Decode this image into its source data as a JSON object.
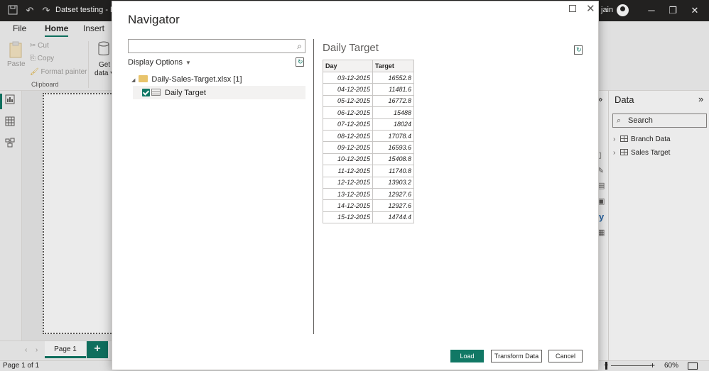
{
  "app": {
    "title": "Datset testing - Po",
    "user_name": "jain"
  },
  "ribbon": {
    "tabs": [
      "File",
      "Home",
      "Insert"
    ],
    "active_tab": "Home",
    "clipboard": {
      "paste": "Paste",
      "cut": "Cut",
      "copy": "Copy",
      "format_painter": "Format painter",
      "group_label": "Clipboard"
    },
    "get_data_line1": "Get",
    "get_data_line2": "data"
  },
  "data_pane": {
    "title": "Data",
    "search_placeholder": "Search",
    "tables": [
      "Branch Data",
      "Sales Target"
    ]
  },
  "pages": {
    "tab": "Page 1",
    "add": "+"
  },
  "status": {
    "page_indicator": "Page 1 of 1",
    "zoom": "60%"
  },
  "navigator": {
    "title": "Navigator",
    "display_options": "Display Options",
    "file_name": "Daily-Sales-Target.xlsx [1]",
    "sheet_name": "Daily Target",
    "sheet_checked": true,
    "preview_title": "Daily Target",
    "columns": [
      "Day",
      "Target"
    ],
    "rows": [
      [
        "03-12-2015",
        "16552.8"
      ],
      [
        "04-12-2015",
        "11481.6"
      ],
      [
        "05-12-2015",
        "16772.8"
      ],
      [
        "06-12-2015",
        "15488"
      ],
      [
        "07-12-2015",
        "18024"
      ],
      [
        "08-12-2015",
        "17078.4"
      ],
      [
        "09-12-2015",
        "16593.6"
      ],
      [
        "10-12-2015",
        "15408.8"
      ],
      [
        "11-12-2015",
        "11740.8"
      ],
      [
        "12-12-2015",
        "13903.2"
      ],
      [
        "13-12-2015",
        "12927.6"
      ],
      [
        "14-12-2015",
        "12927.6"
      ],
      [
        "15-12-2015",
        "14744.4"
      ]
    ],
    "buttons": {
      "load": "Load",
      "transform": "Transform Data",
      "cancel": "Cancel"
    }
  },
  "colors": {
    "accent": "#117865",
    "titlebar": "#252423",
    "folder": "#e8c46c"
  }
}
